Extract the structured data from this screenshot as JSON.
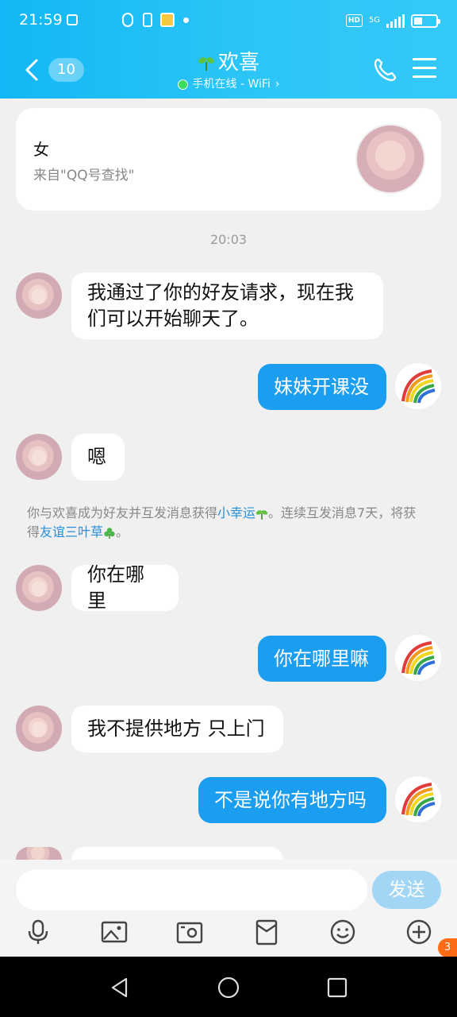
{
  "status_bar": {
    "time": "21:59",
    "network": "5G",
    "hd": "HD"
  },
  "header": {
    "unread_count": "10",
    "contact_name": "欢喜",
    "presence": "手机在线 - WiFi",
    "presence_chevron": "›"
  },
  "profile_card": {
    "gender": "女",
    "source": "来自\"QQ号查找\""
  },
  "timestamp": "20:03",
  "messages": [
    {
      "from": "them",
      "line1": "我通过了你的好友请求，现在我",
      "line2": "们可以开始聊天了。"
    },
    {
      "from": "me",
      "text": "妹妹开课没"
    },
    {
      "from": "them",
      "text": "嗯"
    },
    {
      "from": "them",
      "text": "你在哪里"
    },
    {
      "from": "me",
      "text": "你在哪里嘛"
    },
    {
      "from": "them",
      "text": "我不提供地方 只上门"
    },
    {
      "from": "me",
      "text": "不是说你有地方吗"
    }
  ],
  "system_message": {
    "part1": "你与欢喜成为好友并互发消息获得",
    "link1": "小幸运",
    "part2": "。连续互发消息7天，将获得",
    "link2": "友谊三叶草",
    "part3": "。"
  },
  "input": {
    "send_label": "发送",
    "placeholder": ""
  },
  "toolbar": {
    "icons": [
      "microphone-icon",
      "photo-icon",
      "camera-icon",
      "red-packet-icon",
      "emoji-icon",
      "plus-icon"
    ],
    "plus_badge": "3"
  },
  "colors": {
    "header": "#12b7f5",
    "bubble_me": "#1b9ef0",
    "link": "#2a8fd8",
    "send_disabled": "#a3d5f4"
  }
}
